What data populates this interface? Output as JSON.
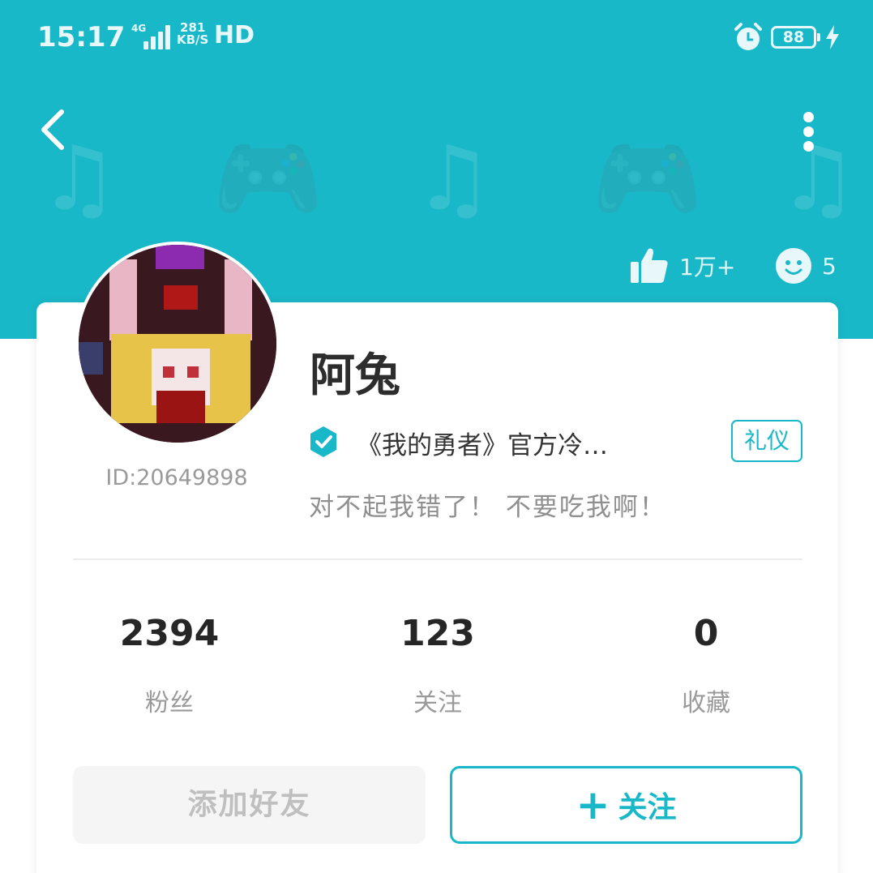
{
  "status_bar": {
    "time": "15:17",
    "network": "4G",
    "speed_value": "281",
    "speed_unit": "KB/S",
    "hd": "HD",
    "battery": "88"
  },
  "header": {
    "likes": "1万+",
    "visitors": "5",
    "colors": {
      "accent": "#19b8c8"
    }
  },
  "profile": {
    "username": "阿兔",
    "user_id": "ID:20649898",
    "verify_text": "《我的勇者》官方冷…",
    "tag": "礼仪",
    "bio": "对不起我错了！ 不要吃我啊！"
  },
  "stats": [
    {
      "value": "2394",
      "label": "粉丝"
    },
    {
      "value": "123",
      "label": "关注"
    },
    {
      "value": "0",
      "label": "收藏"
    }
  ],
  "actions": {
    "add_friend": "添加好友",
    "follow_plus": "+",
    "follow": "关注"
  },
  "icons": [
    "back-arrow-icon",
    "more-vertical-icon",
    "thumbs-up-icon",
    "smiley-icon",
    "verified-badge-icon",
    "alarm-icon",
    "battery-icon",
    "charging-bolt-icon",
    "signal-icon"
  ]
}
